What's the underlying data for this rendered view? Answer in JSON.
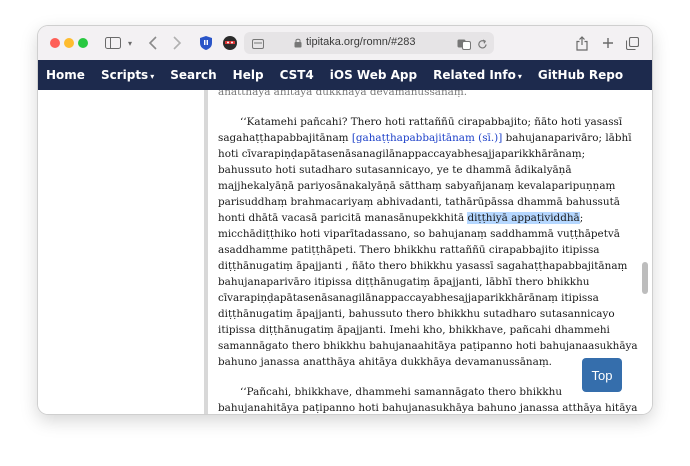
{
  "browser": {
    "url": "tipitaka.org/romn/#283",
    "icons": [
      "sidebar-icon",
      "back-icon",
      "forward-icon",
      "shield-icon",
      "extension-icon",
      "site-settings-icon",
      "lock-icon",
      "translate-icon",
      "reload-icon",
      "share-icon",
      "new-tab-icon",
      "tabs-overview-icon"
    ]
  },
  "navbar": {
    "items": [
      {
        "label": "Home"
      },
      {
        "label": "Scripts",
        "dropdown": true
      },
      {
        "label": "Search"
      },
      {
        "label": "Help"
      },
      {
        "label": "CST4"
      },
      {
        "label": "iOS Web App"
      },
      {
        "label": "Related Info",
        "dropdown": true
      },
      {
        "label": "GitHub Repo"
      }
    ],
    "caret": "▾",
    "bg_color": "#1d2a4d"
  },
  "content": {
    "cut_line": "anatthāya ahitāya dukkhāya devamanussānaṃ.",
    "para1": {
      "open": "‘‘Katamehi pañcahi? Thero hoti rattaññū cirapabbajito; ñāto hoti yasassī sagahaṭṭhapabbajitānaṃ ",
      "link": "[gahaṭṭhapabbajitānaṃ (sī.)]",
      "mid": " bahujanaparivāro; lābhī hoti cīvarapiṇḍapātasenāsanagilānappaccayabhesajjaparikkhārānaṃ; bahussuto hoti sutadharo sutasannicayo, ye te dhammā ādikalyāṇā majjhekalyāṇā pariyosānakalyāṇā sātthaṃ sabyañjanaṃ kevalaparipuṇṇaṃ parisuddhaṃ brahmacariyaṃ abhivadanti, tathārūpāssa dhammā bahussutā honti dhātā vacasā paricitā manasānupekkhitā ",
      "highlight": "diṭṭhiyā appaṭividdhā",
      "close": "; micchādiṭṭhiko hoti viparītadassano, so bahujanaṃ saddhammā vuṭṭhāpetvā asaddhamme patiṭṭhāpeti. Thero bhikkhu rattaññū cirapabbajito itipissa diṭṭhānugatiṃ āpajjanti , ñāto thero bhikkhu yasassī sagahaṭṭhapabbajitānaṃ bahujanaparivāro itipissa diṭṭhānugatiṃ āpajjanti, lābhī thero bhikkhu cīvarapiṇḍapātasenāsanagilānappaccayabhesajjaparikkhārānaṃ itipissa diṭṭhānugatiṃ āpajjanti, bahussuto thero bhikkhu sutadharo sutasannicayo itipissa diṭṭhānugatiṃ āpajjanti. Imehi kho, bhikkhave, pañcahi dhammehi samannāgato thero bhikkhu bahujanaahitāya paṭipanno hoti bahujanaasukhāya bahuno janassa anatthāya ahitāya dukkhāya devamanussānaṃ."
    },
    "para2": "‘‘Pañcahi, bhikkhave, dhammehi samannāgato thero bhikkhu bahujanahitāya paṭipanno hoti bahujanasukhāya bahuno janassa atthāya hitāya sukhāya devamanussānaṃ."
  },
  "top_button": {
    "label": "Top",
    "color": "#356eac"
  },
  "highlight_color": "#b5d7ff",
  "link_color": "#1b3fc9"
}
